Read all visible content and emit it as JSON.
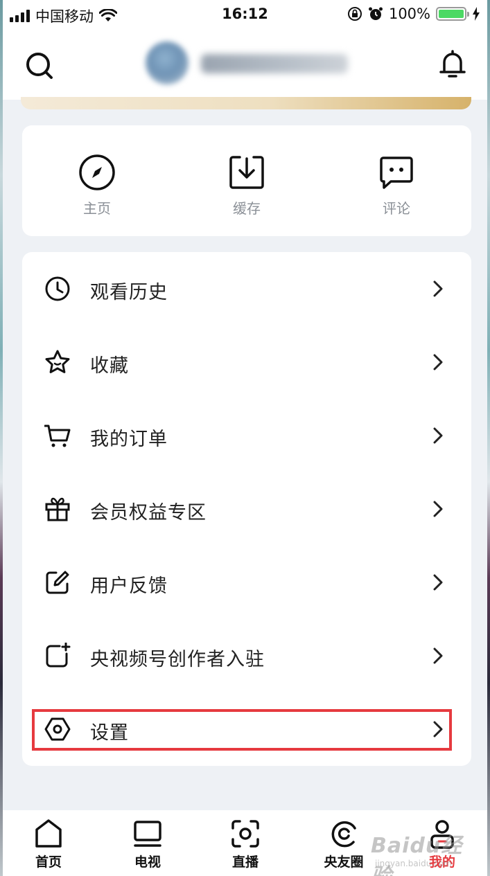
{
  "status_bar": {
    "carrier": "中国移动",
    "time": "16:12",
    "battery": "100%"
  },
  "header": {
    "search_icon": "search-icon",
    "bell_icon": "bell-icon"
  },
  "quick_actions": [
    {
      "icon": "compass-icon",
      "label": "主页"
    },
    {
      "icon": "download-icon",
      "label": "缓存"
    },
    {
      "icon": "comment-icon",
      "label": "评论"
    }
  ],
  "menu": {
    "items": [
      {
        "icon": "clock-icon",
        "label": "观看历史"
      },
      {
        "icon": "star-icon",
        "label": "收藏"
      },
      {
        "icon": "cart-icon",
        "label": "我的订单"
      },
      {
        "icon": "gift-icon",
        "label": "会员权益专区"
      },
      {
        "icon": "edit-icon",
        "label": "用户反馈"
      },
      {
        "icon": "add-creator-icon",
        "label": "央视频号创作者入驻"
      },
      {
        "icon": "settings-icon",
        "label": "设置"
      }
    ],
    "highlighted_item": "设置",
    "highlight_color": "#e63a3f"
  },
  "bottom_nav": {
    "items": [
      {
        "icon": "home-icon",
        "label": "首页"
      },
      {
        "icon": "tv-icon",
        "label": "电视"
      },
      {
        "icon": "live-icon",
        "label": "直播"
      },
      {
        "icon": "circle-icon",
        "label": "央友圈"
      },
      {
        "icon": "profile-icon",
        "label": "我的"
      }
    ],
    "active": "我的",
    "active_color": "#e63a3f"
  },
  "watermark": {
    "main": "Baidu经验",
    "sub": "jingyan.baidu.com"
  }
}
